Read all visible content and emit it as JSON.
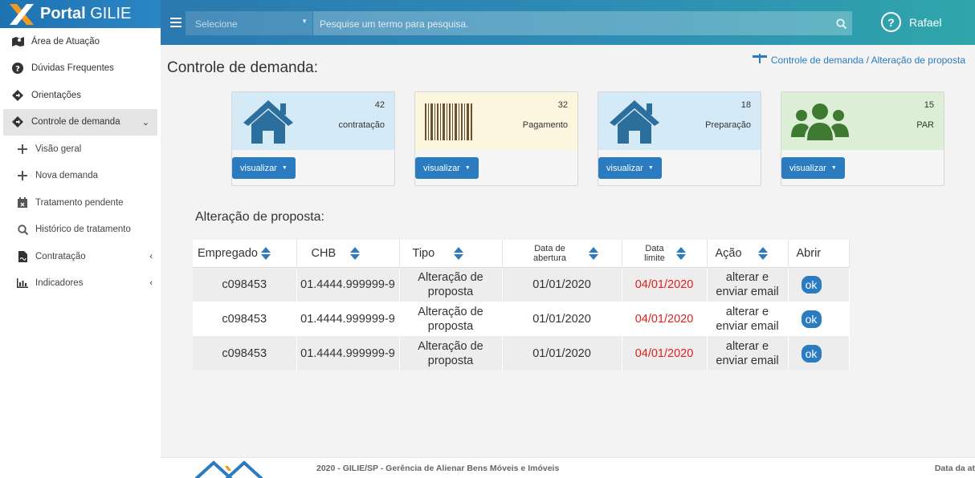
{
  "brand": {
    "bold": "Portal",
    "rest": " GILIE"
  },
  "sidebar": {
    "items": [
      {
        "label": "Área de Atuação",
        "icon": "map-icon"
      },
      {
        "label": "Dúvidas Frequentes",
        "icon": "question-circle-icon"
      },
      {
        "label": "Orientações",
        "icon": "directions-icon"
      },
      {
        "label": "Controle de demanda",
        "icon": "directions-icon"
      },
      {
        "label": "Visão geral",
        "icon": "plus-icon"
      },
      {
        "label": "Nova demanda",
        "icon": "plus-icon"
      },
      {
        "label": "Tratamento pendente",
        "icon": "calendar-x-icon"
      },
      {
        "label": "Histórico de tratamento",
        "icon": "search-dollar-icon"
      },
      {
        "label": "Contratação",
        "icon": "file-signature-icon"
      },
      {
        "label": "Indicadores",
        "icon": "bar-chart-icon"
      }
    ]
  },
  "topbar": {
    "select_value": "Selecione",
    "search_placeholder": "Pesquise um termo para pesquisa.",
    "user_name": "Rafael"
  },
  "page": {
    "title": "Controle de demanda:",
    "breadcrumb": "Controle de demanda / Alteração de proposta"
  },
  "cards": [
    {
      "count": "42",
      "label": "contratação",
      "button": "visualizar",
      "icon": "house-icon"
    },
    {
      "count": "32",
      "label": "Pagamento",
      "button": "visualizar",
      "icon": "barcode-icon"
    },
    {
      "count": "18",
      "label": "Preparação",
      "button": "visualizar",
      "icon": "house-icon"
    },
    {
      "count": "15",
      "label": "PAR",
      "button": "visualizar",
      "icon": "users-icon"
    }
  ],
  "table": {
    "title": "Alteração de proposta:",
    "headers": [
      "Empregado",
      "CHB",
      "Tipo",
      "Data de abertura",
      "Data limite",
      "Ação",
      "Abrir"
    ],
    "rows": [
      {
        "empregado": "c098453",
        "chb": "01.4444.999999-9",
        "tipo": "Alteração de proposta",
        "abertura": "01/01/2020",
        "limite": "04/01/2020",
        "acao": "alterar e enviar email",
        "abrir": "ok"
      },
      {
        "empregado": "c098453",
        "chb": "01.4444.999999-9",
        "tipo": "Alteração de proposta",
        "abertura": "01/01/2020",
        "limite": "04/01/2020",
        "acao": "alterar e enviar email",
        "abrir": "ok"
      },
      {
        "empregado": "c098453",
        "chb": "01.4444.999999-9",
        "tipo": "Alteração de proposta",
        "abertura": "01/01/2020",
        "limite": "04/01/2020",
        "acao": "alterar e enviar email",
        "abrir": "ok"
      }
    ]
  },
  "footer": {
    "text": "2020 - GILIE/SP - Gerência de Alienar Bens Móveis e Imóveis",
    "right": "Data da at"
  },
  "colors": {
    "primary": "#2a7bbf",
    "deadline": "#e0201b",
    "teal": "#2fa6aa"
  }
}
